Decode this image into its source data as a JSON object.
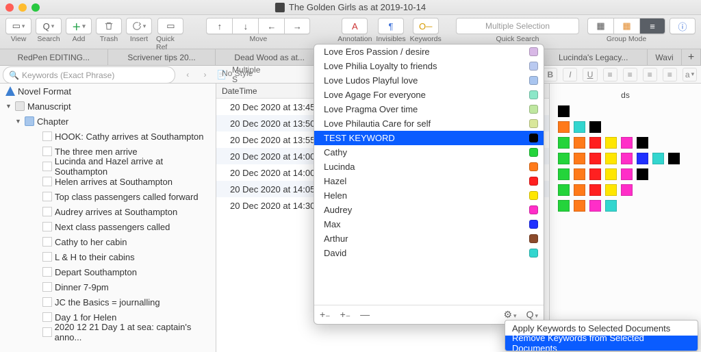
{
  "window": {
    "title": "The Golden Girls as at 2019-10-14"
  },
  "toolbar": {
    "view": "View",
    "search": "Search",
    "add": "Add",
    "trash": "Trash",
    "insert": "Insert",
    "quickref": "Quick Ref",
    "move": "Move",
    "annotation": "Annotation",
    "invisibles": "Invisibles",
    "keywords": "Keywords",
    "quick_search_placeholder": "Multiple Selection",
    "quick_search_label": "Quick Search",
    "group_mode": "Group Mode"
  },
  "tabs": [
    "RedPen EDITING...",
    "Scrivener tips 20...",
    "Dead Wood as at...",
    "",
    "",
    "Lucinda's Legacy...",
    "Wavi"
  ],
  "binder_search_placeholder": "Keywords (Exact Phrase)",
  "style_bar": {
    "no_style": "No Style"
  },
  "binder": {
    "root": "Novel Format",
    "manuscript": "Manuscript",
    "chapter": "Chapter",
    "scenes": [
      "HOOK: Cathy arrives at Southampton",
      "The three men arrive",
      "Lucinda and Hazel arrive at Southampton",
      "Helen arrives at Southampton",
      "Top class passengers called forward",
      "Audrey arrives at Southampton",
      "Next class passengers called",
      "Cathy to her cabin",
      "L & H to their cabins",
      "Depart Southampton",
      "Dinner 7-9pm",
      "JC the Basics = journalling",
      "Day 1 for Helen",
      "2020 12 21 Day 1 at sea: captain's anno..."
    ]
  },
  "editor": {
    "breadcrumb": "Multiple S",
    "col_datetime": "DateTime",
    "col_keywords": "ds",
    "rows": [
      "20 Dec 2020 at 13:45",
      "20 Dec 2020 at 13:50",
      "20 Dec 2020 at 13:55",
      "20 Dec 2020 at 14:00",
      "20 Dec 2020 at 14:00",
      "20 Dec 2020 at 14:05",
      "20 Dec 2020 at 14:30"
    ]
  },
  "keywords": [
    {
      "label": "Love Eros Passion / desire",
      "color": "#d8b8e6"
    },
    {
      "label": "Love Philia Loyalty to friends",
      "color": "#b9c9f0"
    },
    {
      "label": "Love Ludos Playful love",
      "color": "#a9c5ef"
    },
    {
      "label": "Love Agage For everyone",
      "color": "#8ce7c8"
    },
    {
      "label": "Love Pragma Over time",
      "color": "#bfe7a0"
    },
    {
      "label": "Love Philautia Care for self",
      "color": "#d9e79a"
    },
    {
      "label": "TEST KEYWORD",
      "color": "#000000",
      "selected": true
    },
    {
      "label": "Cathy",
      "color": "#24d43b"
    },
    {
      "label": "Lucinda",
      "color": "#ff7a1a"
    },
    {
      "label": "Hazel",
      "color": "#ff2020"
    },
    {
      "label": "Helen",
      "color": "#ffe600"
    },
    {
      "label": "Audrey",
      "color": "#ff2ec8"
    },
    {
      "label": "Max",
      "color": "#2030ff"
    },
    {
      "label": "Arthur",
      "color": "#8b4a2b"
    },
    {
      "label": "David",
      "color": "#33d6cf"
    }
  ],
  "inspector_rows": [
    [
      "#000000"
    ],
    [
      "#ff7a1a",
      "#33d6cf",
      "#000000"
    ],
    [
      "#24d43b",
      "#ff7a1a",
      "#ff2020",
      "#ffe600",
      "#ff2ec8",
      "#000000"
    ],
    [
      "#24d43b",
      "#ff7a1a",
      "#ff2020",
      "#ffe600",
      "#ff2ec8",
      "#2030ff",
      "#33d6cf",
      "#000000"
    ],
    [
      "#24d43b",
      "#ff7a1a",
      "#ff2020",
      "#ffe600",
      "#ff2ec8",
      "#000000"
    ],
    [
      "#24d43b",
      "#ff7a1a",
      "#ff2020",
      "#ffe600",
      "#ff2ec8"
    ],
    [
      "#24d43b",
      "#ff7a1a",
      "#ff2ec8",
      "#33d6cf"
    ]
  ],
  "context_menu": {
    "apply": "Apply Keywords to Selected Documents",
    "remove": "Remove Keywords from Selected Documents"
  }
}
